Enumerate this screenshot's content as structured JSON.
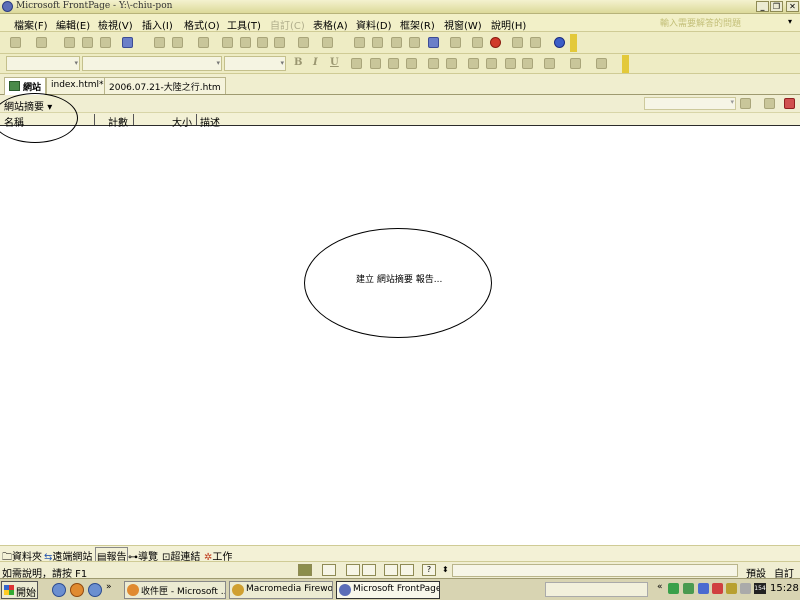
{
  "window": {
    "title": "Microsoft FrontPage - Y:\\-chiu-pon"
  },
  "menu": {
    "items": [
      "檔案(F)",
      "編輯(E)",
      "檢視(V)",
      "插入(I)",
      "格式(O)",
      "工具(T)",
      "自訂(C)",
      "表格(A)",
      "資料(D)",
      "框架(R)",
      "視窗(W)",
      "說明(H)"
    ],
    "help_placeholder": "輸入需要解答的問題"
  },
  "toolbar": {
    "formatting": {
      "bold": "B",
      "italic": "I",
      "underline": "U"
    }
  },
  "tabs": [
    {
      "label": "網站",
      "active": true
    },
    {
      "label": "index.html*",
      "active": false
    },
    {
      "label": "2006.07.21-大陸之行.htm",
      "active": false
    }
  ],
  "report": {
    "name": "網站摘要",
    "columns": [
      "名稱",
      "計數",
      "大小",
      "描述"
    ],
    "message": "建立 網站摘要 報告..."
  },
  "views": [
    {
      "label": "資料夾",
      "selected": false
    },
    {
      "label": "遠端網站",
      "selected": false
    },
    {
      "label": "報告",
      "selected": true
    },
    {
      "label": "導覽",
      "selected": false
    },
    {
      "label": "超連結",
      "selected": false
    },
    {
      "label": "工作",
      "selected": false
    }
  ],
  "status": {
    "text": "如需說明，請按 F1",
    "mode_default": "預設",
    "mode_custom": "自訂"
  },
  "taskbar": {
    "start_label": "開始",
    "tasks": [
      {
        "label": "收件匣 - Microsoft ...",
        "active": false
      },
      {
        "label": "Macromedia Firewo...",
        "active": false
      },
      {
        "label": "Microsoft FrontPage...",
        "active": true
      }
    ],
    "tray_badge": "154",
    "clock": "15:28"
  },
  "colors": {
    "office_bg": "#f0eed2",
    "toolbar_bg": "#eeecc4",
    "taskbar_bg": "#d8d4b2",
    "accent_yellow": "#e3c93a"
  }
}
